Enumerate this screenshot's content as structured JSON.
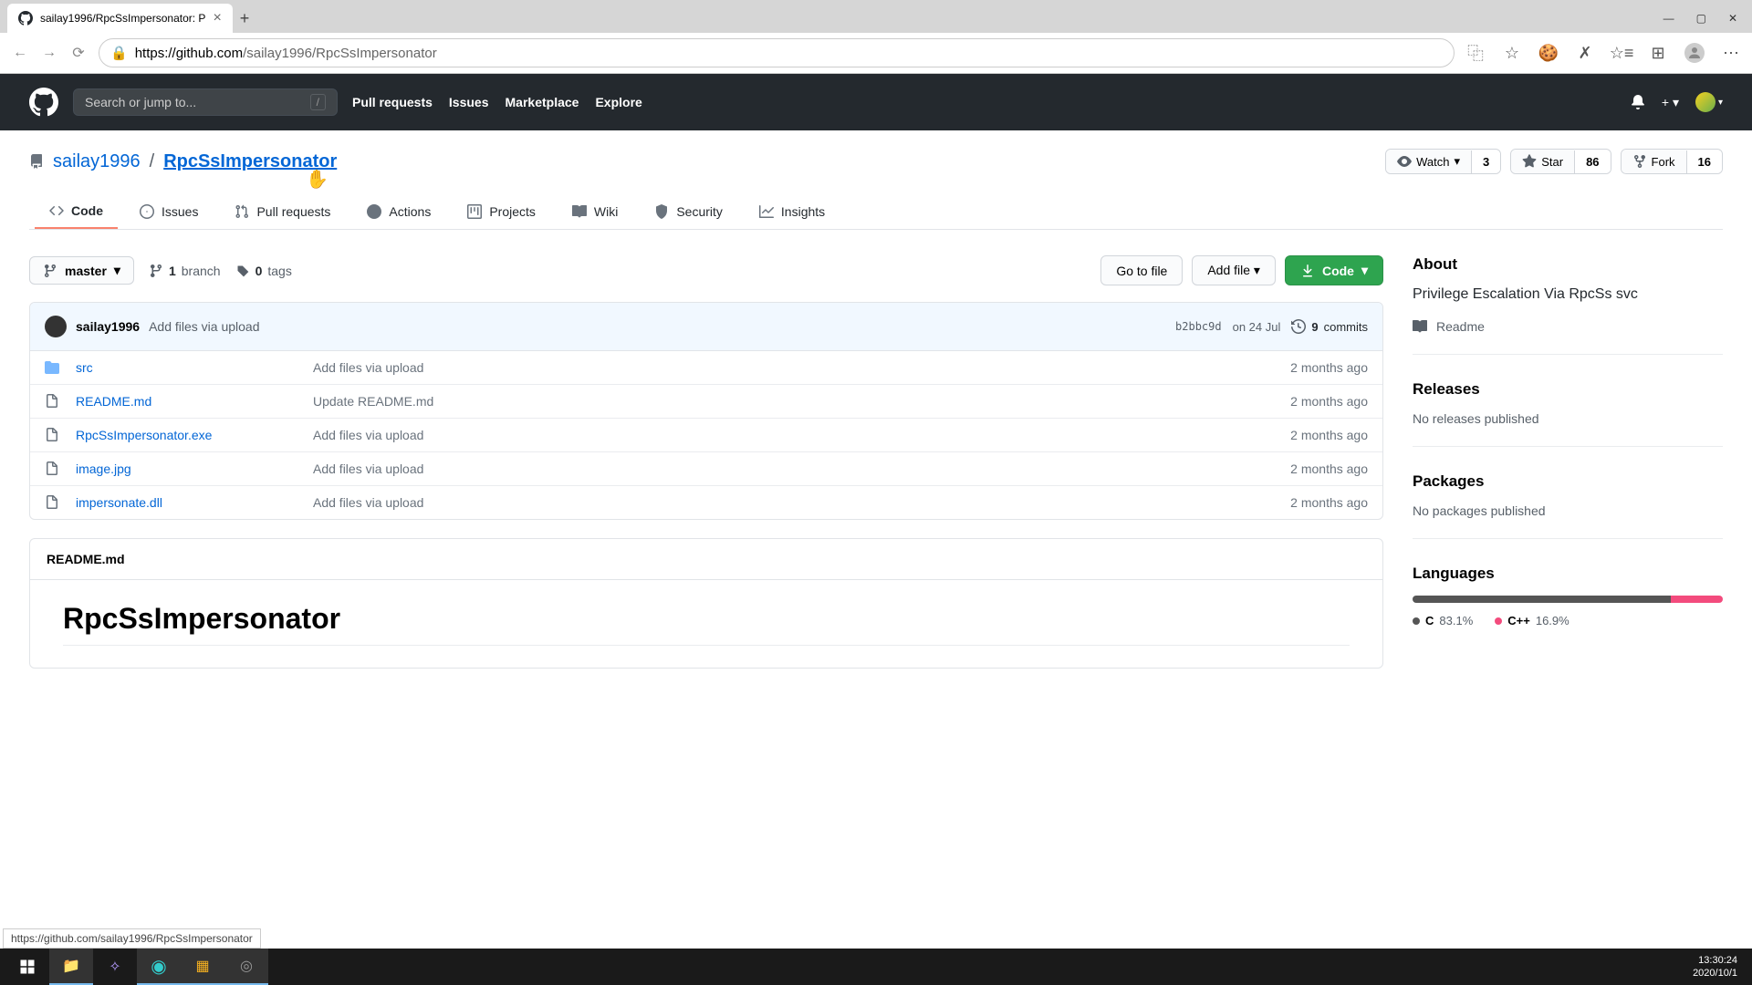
{
  "browser": {
    "tab_title": "sailay1996/RpcSsImpersonator: P",
    "url_domain": "https://github.com",
    "url_path": "/sailay1996/RpcSsImpersonator",
    "hover_url": "https://github.com/sailay1996/RpcSsImpersonator"
  },
  "gh_header": {
    "search_placeholder": "Search or jump to...",
    "nav": [
      "Pull requests",
      "Issues",
      "Marketplace",
      "Explore"
    ]
  },
  "repo": {
    "owner": "sailay1996",
    "name": "RpcSsImpersonator",
    "watch_label": "Watch",
    "watch_count": "3",
    "star_label": "Star",
    "star_count": "86",
    "fork_label": "Fork",
    "fork_count": "16"
  },
  "tabs": [
    {
      "label": "Code"
    },
    {
      "label": "Issues"
    },
    {
      "label": "Pull requests"
    },
    {
      "label": "Actions"
    },
    {
      "label": "Projects"
    },
    {
      "label": "Wiki"
    },
    {
      "label": "Security"
    },
    {
      "label": "Insights"
    }
  ],
  "filebar": {
    "branch": "master",
    "branches_n": "1",
    "branches_l": "branch",
    "tags_n": "0",
    "tags_l": "tags",
    "go_to_file": "Go to file",
    "add_file": "Add file",
    "code": "Code"
  },
  "commit": {
    "author": "sailay1996",
    "message": "Add files via upload",
    "sha": "b2bbc9d",
    "date": "on 24 Jul",
    "commits_n": "9",
    "commits_l": "commits"
  },
  "files": [
    {
      "type": "dir",
      "name": "src",
      "msg": "Add files via upload",
      "time": "2 months ago"
    },
    {
      "type": "file",
      "name": "README.md",
      "msg": "Update README.md",
      "time": "2 months ago"
    },
    {
      "type": "file",
      "name": "RpcSsImpersonator.exe",
      "msg": "Add files via upload",
      "time": "2 months ago"
    },
    {
      "type": "file",
      "name": "image.jpg",
      "msg": "Add files via upload",
      "time": "2 months ago"
    },
    {
      "type": "file",
      "name": "impersonate.dll",
      "msg": "Add files via upload",
      "time": "2 months ago"
    }
  ],
  "readme": {
    "file": "README.md",
    "title": "RpcSsImpersonator"
  },
  "sidebar": {
    "about": "About",
    "desc": "Privilege Escalation Via RpcSs svc",
    "readme": "Readme",
    "releases": "Releases",
    "releases_empty": "No releases published",
    "packages": "Packages",
    "packages_empty": "No packages published",
    "languages": "Languages",
    "langs": [
      {
        "name": "C",
        "pct": "83.1%",
        "color": "#555"
      },
      {
        "name": "C++",
        "pct": "16.9%",
        "color": "#f34b7d"
      }
    ]
  },
  "taskbar": {
    "time": "13:30:24",
    "date": "2020/10/1"
  }
}
